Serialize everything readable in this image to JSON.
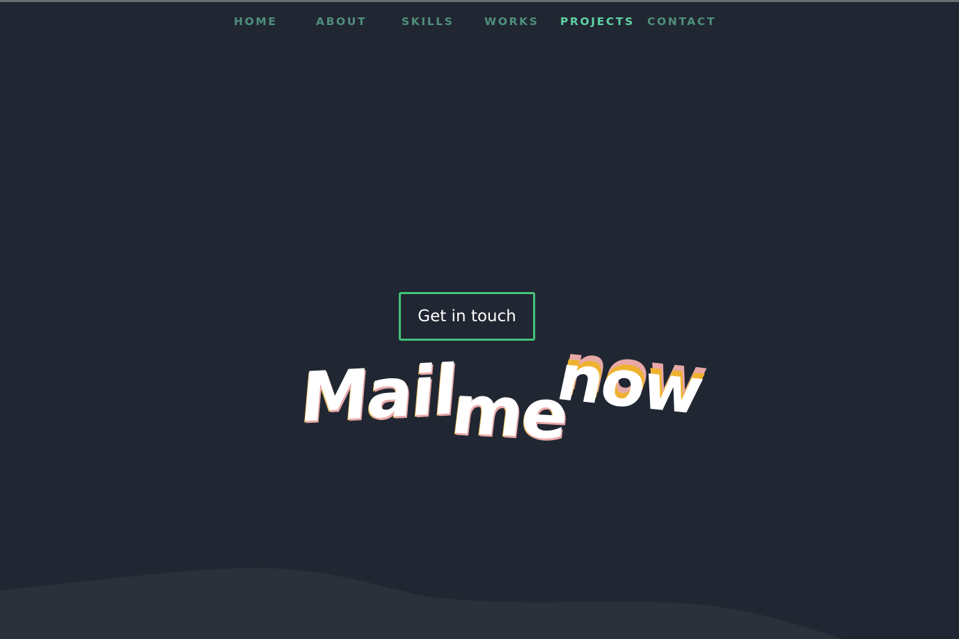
{
  "nav": {
    "items": [
      {
        "label": "HOME",
        "active": false
      },
      {
        "label": "ABOUT",
        "active": false
      },
      {
        "label": "SKILLS",
        "active": false
      },
      {
        "label": "WORKS",
        "active": false
      },
      {
        "label": "PROJECTS",
        "active": true
      },
      {
        "label": "CONTACT",
        "active": false
      }
    ]
  },
  "hero": {
    "button_label": "Get in touch",
    "headline": {
      "word1": "Mail",
      "word2": "me",
      "word3": "now"
    }
  },
  "colors": {
    "background": "#212732",
    "wave": "#2a313b",
    "nav_text": "#4f8f7c",
    "nav_active": "#5fd3a3",
    "button_border": "#44c27a",
    "accent_pink": "#e8a8a8",
    "accent_yellow": "#efb230"
  }
}
